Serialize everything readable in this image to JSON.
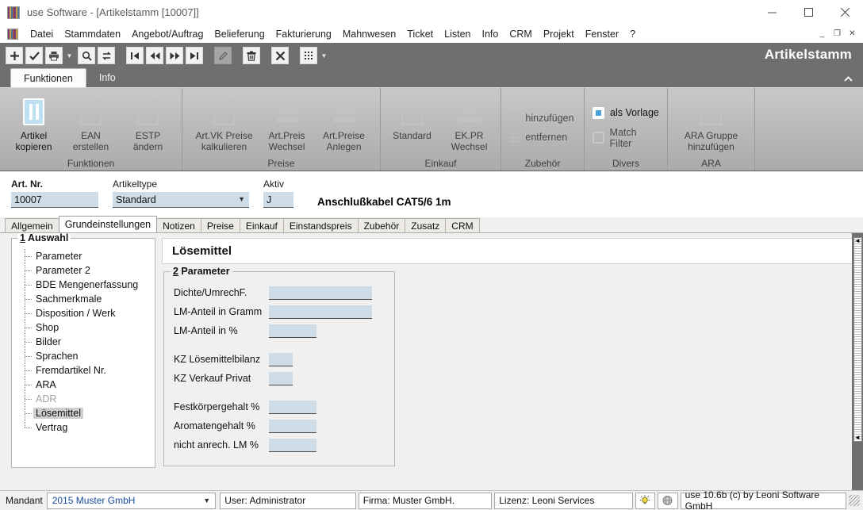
{
  "window": {
    "title": "use Software  -  [Artikelstamm [10007]]",
    "app_icon": "app-grid-icon",
    "controls": {
      "minimize": "minimize-icon",
      "maximize": "maximize-icon",
      "close": "close-icon"
    },
    "mdi_controls": {
      "minimize": "_",
      "restore": "❐",
      "close": "✕"
    }
  },
  "menubar": {
    "items": [
      "Datei",
      "Stammdaten",
      "Angebot/Auftrag",
      "Belieferung",
      "Fakturierung",
      "Mahnwesen",
      "Ticket",
      "Listen",
      "Info",
      "CRM",
      "Projekt",
      "Fenster",
      "?"
    ]
  },
  "toolbar": {
    "ribbon_title": "Artikelstamm",
    "buttons": [
      {
        "name": "new-record-button",
        "icon": "plus-icon",
        "enabled": true
      },
      {
        "name": "confirm-button",
        "icon": "check-icon",
        "enabled": true
      },
      {
        "name": "print-button",
        "icon": "printer-icon",
        "enabled": true,
        "caret": true
      },
      {
        "name": "search-button",
        "icon": "search-icon",
        "enabled": true
      },
      {
        "name": "refresh-button",
        "icon": "refresh-icon",
        "enabled": true
      },
      {
        "name": "first-record-button",
        "icon": "first-icon",
        "enabled": true
      },
      {
        "name": "previous-record-button",
        "icon": "previous-icon",
        "enabled": true
      },
      {
        "name": "next-record-button",
        "icon": "next-icon",
        "enabled": true
      },
      {
        "name": "last-record-button",
        "icon": "last-icon",
        "enabled": true
      },
      {
        "name": "edit-button",
        "icon": "pencil-icon",
        "enabled": false
      },
      {
        "name": "delete-button",
        "icon": "trash-icon",
        "enabled": true
      },
      {
        "name": "cancel-button",
        "icon": "close-x-icon",
        "enabled": true
      },
      {
        "name": "grid-view-button",
        "icon": "grid-icon",
        "enabled": true,
        "caret": true
      }
    ]
  },
  "ribbon": {
    "tabs": [
      {
        "label": "Funktionen",
        "active": true
      },
      {
        "label": "Info",
        "active": false
      }
    ],
    "collapse_icon": "chevron-up-icon",
    "groups": [
      {
        "label": "Funktionen",
        "buttons": [
          {
            "label": "Artikel\nkopieren",
            "enabled": true,
            "selected": true,
            "has_dropdown": true,
            "icon": "copy-article-icon"
          },
          {
            "label": "EAN\nerstellen",
            "enabled": false,
            "icon": "ean-icon"
          },
          {
            "label": "ESTP\nändern",
            "enabled": false,
            "icon": "estp-icon"
          }
        ]
      },
      {
        "label": "Preise",
        "buttons": [
          {
            "label": "Art.VK Preise\nkalkulieren",
            "enabled": false,
            "icon": "price-calc-icon"
          },
          {
            "label": "Art.Preis\nWechsel",
            "enabled": false,
            "icon": "price-change-icon"
          },
          {
            "label": "Art.Preise\nAnlegen",
            "enabled": false,
            "icon": "price-create-icon"
          }
        ]
      },
      {
        "label": "Einkauf",
        "buttons": [
          {
            "label": "Standard",
            "enabled": false,
            "icon": "standard-icon"
          },
          {
            "label": "EK.PR\nWechsel",
            "enabled": false,
            "icon": "ekpr-change-icon"
          }
        ]
      },
      {
        "label": "Zubehör",
        "small_buttons": [
          {
            "label": "hinzufügen",
            "enabled": false,
            "icon": "add-lines-icon"
          },
          {
            "label": "entfernen",
            "enabled": false,
            "icon": "remove-lines-icon"
          }
        ]
      },
      {
        "label": "Divers",
        "small_buttons": [
          {
            "label": "als Vorlage",
            "enabled": true,
            "checked": true,
            "icon": "template-checkbox-icon"
          },
          {
            "label": "Match Filter",
            "enabled": false,
            "checked": false,
            "icon": "match-filter-checkbox-icon"
          }
        ]
      },
      {
        "label": "ARA",
        "buttons": [
          {
            "label": "ARA Gruppe\nhinzufügen",
            "enabled": false,
            "icon": "ara-group-icon"
          }
        ]
      }
    ]
  },
  "header": {
    "fields": [
      {
        "name": "article-number",
        "label": "Art. Nr.",
        "value": "10007",
        "bold": true
      },
      {
        "name": "article-type",
        "label": "Artikeltype",
        "value": "Standard",
        "type": "select"
      },
      {
        "name": "active-flag",
        "label": "Aktiv",
        "value": "J"
      }
    ],
    "document_title": "Anschlußkabel CAT5/6 1m"
  },
  "doc_tabs": [
    {
      "label": "Allgemein",
      "active": false
    },
    {
      "label": "Grundeinstellungen",
      "active": true
    },
    {
      "label": "Notizen",
      "active": false
    },
    {
      "label": "Preise",
      "active": false
    },
    {
      "label": "Einkauf",
      "active": false
    },
    {
      "label": "Einstandspreis",
      "active": false
    },
    {
      "label": "Zubehör",
      "active": false
    },
    {
      "label": "Zusatz",
      "active": false
    },
    {
      "label": "CRM",
      "active": false
    }
  ],
  "tree": {
    "legend_number": "1",
    "legend_text": " Auswahl",
    "nodes": [
      {
        "label": "Parameter",
        "selected": false,
        "disabled": false
      },
      {
        "label": "Parameter 2",
        "selected": false,
        "disabled": false
      },
      {
        "label": "BDE Mengenerfassung",
        "selected": false,
        "disabled": false
      },
      {
        "label": "Sachmerkmale",
        "selected": false,
        "disabled": false
      },
      {
        "label": "Disposition / Werk",
        "selected": false,
        "disabled": false
      },
      {
        "label": "Shop",
        "selected": false,
        "disabled": false
      },
      {
        "label": "Bilder",
        "selected": false,
        "disabled": false
      },
      {
        "label": "Sprachen",
        "selected": false,
        "disabled": false
      },
      {
        "label": "Fremdartikel Nr.",
        "selected": false,
        "disabled": false
      },
      {
        "label": "ARA",
        "selected": false,
        "disabled": false
      },
      {
        "label": "ADR",
        "selected": false,
        "disabled": true
      },
      {
        "label": "Lösemittel",
        "selected": true,
        "disabled": false
      },
      {
        "label": "Vertrag",
        "selected": false,
        "disabled": false
      }
    ]
  },
  "detail": {
    "title": "Lösemittel",
    "group": {
      "legend_number": "2",
      "legend_text": " Parameter",
      "rows": [
        {
          "label": "Dichte/UmrechF.",
          "value": "",
          "width": 130,
          "spacer_before": false
        },
        {
          "label": "LM-Anteil in Gramm",
          "value": "",
          "width": 130,
          "spacer_before": false
        },
        {
          "label": "LM-Anteil in %",
          "value": "",
          "width": 60,
          "spacer_before": false
        },
        {
          "label": "KZ Lösemittelbilanz",
          "value": "",
          "width": 30,
          "spacer_before": true
        },
        {
          "label": "KZ Verkauf Privat",
          "value": "",
          "width": 30,
          "spacer_before": false
        },
        {
          "label": "Festkörpergehalt %",
          "value": "",
          "width": 60,
          "spacer_before": true
        },
        {
          "label": "Aromatengehalt %",
          "value": "",
          "width": 60,
          "spacer_before": false
        },
        {
          "label": "nicht anrech. LM %",
          "value": "",
          "width": 60,
          "spacer_before": false
        }
      ]
    }
  },
  "statusbar": {
    "mandant_label": "Mandant",
    "mandant_value": "2015 Muster GmbH",
    "user": "User: Administrator",
    "firma": "Firma: Muster GmbH.",
    "lizenz": "Lizenz: Leoni Services",
    "icon_hint": "lightbulb-icon",
    "icon_info": "globe-icon",
    "version": "use 10.6b (c) by Leoni Software GmbH"
  },
  "colors": {
    "ribbon_bg": "#6f6f6f",
    "field_fill": "#cddce6",
    "accent": "#bde0f2",
    "status_link": "#15489c"
  }
}
